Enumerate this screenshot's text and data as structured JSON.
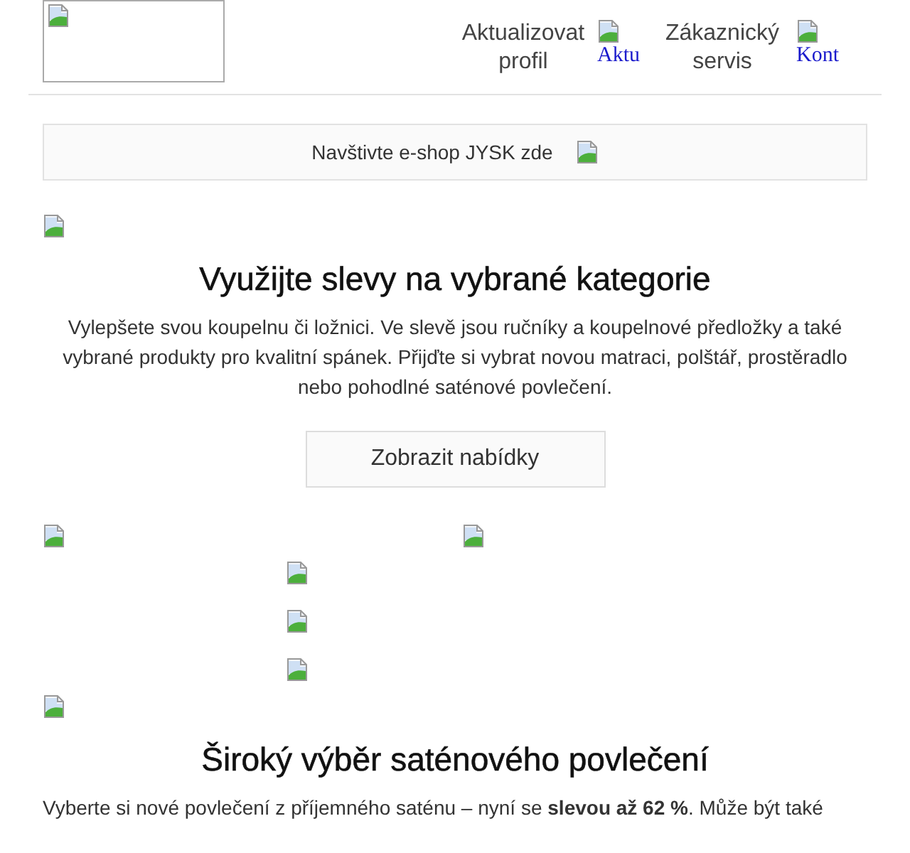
{
  "header": {
    "links": [
      {
        "label": "Aktualizovat profil",
        "icon_alt": "Aktu"
      },
      {
        "label": "Zákaznický servis",
        "icon_alt": "Kont"
      }
    ]
  },
  "banner": {
    "text": "Navštivte e-shop JYSK zde"
  },
  "promo": {
    "heading": "Využijte slevy na vybrané kategorie",
    "text": "Vylepšete svou koupelnu či ložnici. Ve slevě jsou ručníky a koupelnové předložky a také vybrané produkty pro kvalitní spánek. Přijďte si vybrat novou matraci, polštář, prostěradlo nebo pohodlné saténové povlečení.",
    "button": "Zobrazit nabídky"
  },
  "satin": {
    "heading": "Široký výběr saténového povlečení",
    "text": "Vyberte si nové povlečení z příjemného saténu – nyní se **slevou až 62 %**. Může být také"
  }
}
